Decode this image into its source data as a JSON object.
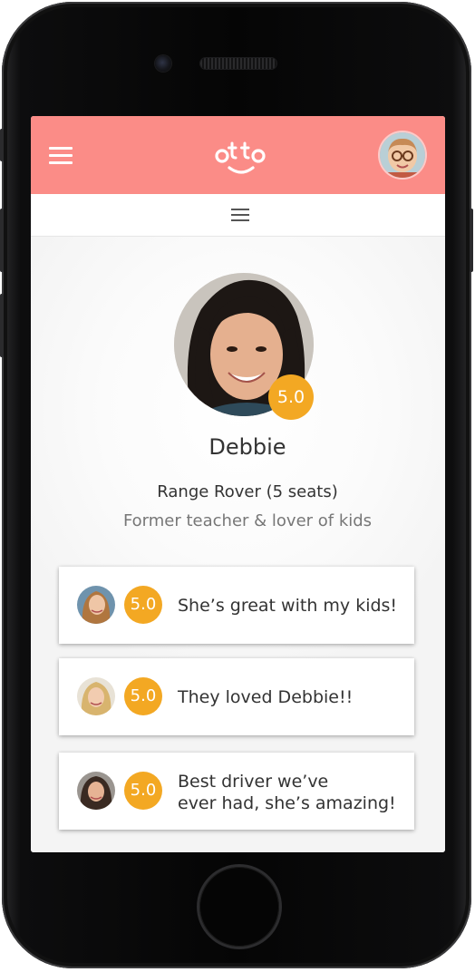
{
  "app": {
    "logo_text": "otto",
    "brand_color": "#fb8c87",
    "badge_color": "#f3a823",
    "icons": {
      "menu": "hamburger-menu-icon",
      "submenu": "hamburger-menu-icon"
    }
  },
  "driver": {
    "name": "Debbie",
    "rating": "5.0",
    "vehicle": "Range Rover (5 seats)",
    "bio": "Former teacher & lover of kids"
  },
  "reviews": [
    {
      "rating": "5.0",
      "lines": [
        "She’s great with my kids!"
      ]
    },
    {
      "rating": "5.0",
      "lines": [
        "They loved Debbie!!"
      ]
    },
    {
      "rating": "5.0",
      "lines": [
        "Best driver we’ve",
        "ever had, she’s amazing!"
      ]
    }
  ]
}
